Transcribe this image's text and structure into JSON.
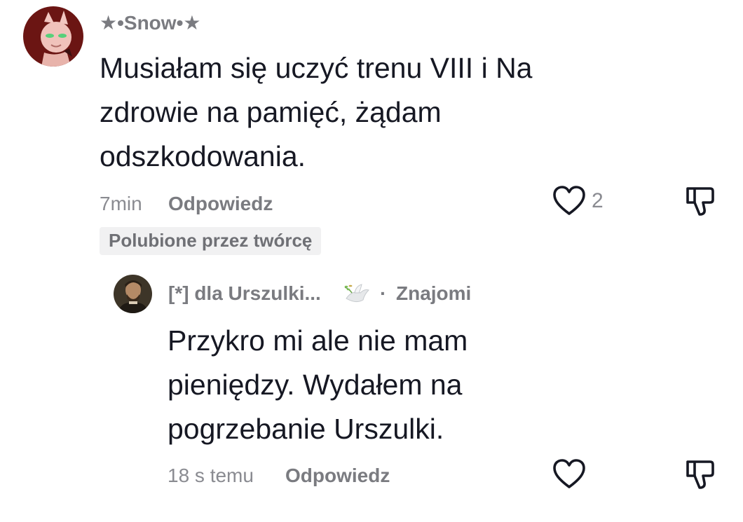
{
  "comment": {
    "username": "★•Snow•★",
    "text_lines": [
      "Musiałam się uczyć trenu VIII i Na",
      "zdrowie na pamięć, żądam",
      "odszkodowania."
    ],
    "time": "7min",
    "reply_label": "Odpowiedz",
    "like_count": "2",
    "creator_badge": "Polubione przez twórcę"
  },
  "reply": {
    "username": "[*] dla Urszulki...",
    "separator": "·",
    "relation": "Znajomi",
    "text_lines": [
      "Przykro mi ale nie mam",
      "pieniędzy. Wydałem na",
      "pogrzebanie Urszulki."
    ],
    "time": "18 s temu",
    "reply_label": "Odpowiedz"
  },
  "icons": {
    "like": "heart-outline-icon",
    "dislike": "thumbs-down-icon",
    "dove": "dove-with-branch-icon"
  },
  "colors": {
    "text": "#161823",
    "muted": "#8a8b91",
    "username": "#7a7b80",
    "badge_bg": "#f1f1f2",
    "avatar_bg": "#6b1513"
  }
}
